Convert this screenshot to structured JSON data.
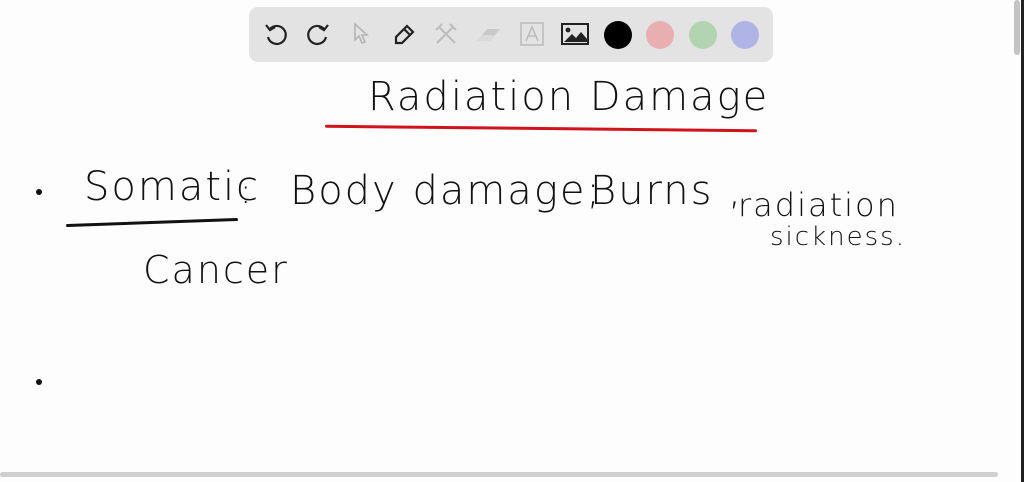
{
  "toolbar": {
    "tools": [
      "undo-icon",
      "redo-icon",
      "select-icon",
      "pen-icon",
      "tools-icon",
      "eraser-icon",
      "text-icon",
      "image-icon"
    ],
    "colors": {
      "black": "#000000",
      "red": "#e8aeb0",
      "green": "#b2d4b0",
      "blue": "#b0b3e6"
    }
  },
  "board": {
    "title": "Radiation Damage",
    "line1_term": "Somatic",
    "line1_colon": ":",
    "line1_text": "Body damage;",
    "line1_text2": "Burns ,",
    "line1_text3": "radiation",
    "line1_text4": "sickness.",
    "line2_text": "Cancer",
    "title_underline_color": "#d0141e"
  }
}
